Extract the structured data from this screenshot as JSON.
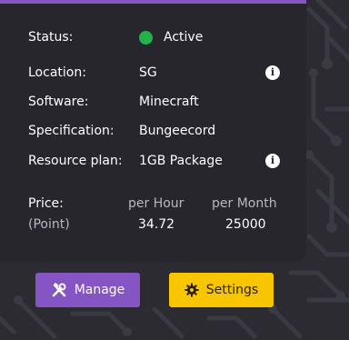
{
  "details": {
    "status_label": "Status:",
    "status_value": "Active",
    "location_label": "Location:",
    "location_value": "SG",
    "software_label": "Software:",
    "software_value": "Minecraft",
    "specification_label": "Specification:",
    "specification_value": "Bungeecord",
    "resource_plan_label": "Resource plan:",
    "resource_plan_value": "1GB Package"
  },
  "price": {
    "label": "Price:",
    "unit": "(Point)",
    "per_hour_label": "per Hour",
    "per_hour_value": "34.72",
    "per_month_label": "per Month",
    "per_month_value": "25000"
  },
  "actions": {
    "manage_label": "Manage",
    "settings_label": "Settings"
  },
  "colors": {
    "accent": "#8655c4",
    "status_active": "#22b34a",
    "settings_button": "#f7c600"
  },
  "icons": {
    "status": "status-dot-icon",
    "info": "info-icon",
    "manage": "tools-icon",
    "settings": "gear-icon"
  }
}
